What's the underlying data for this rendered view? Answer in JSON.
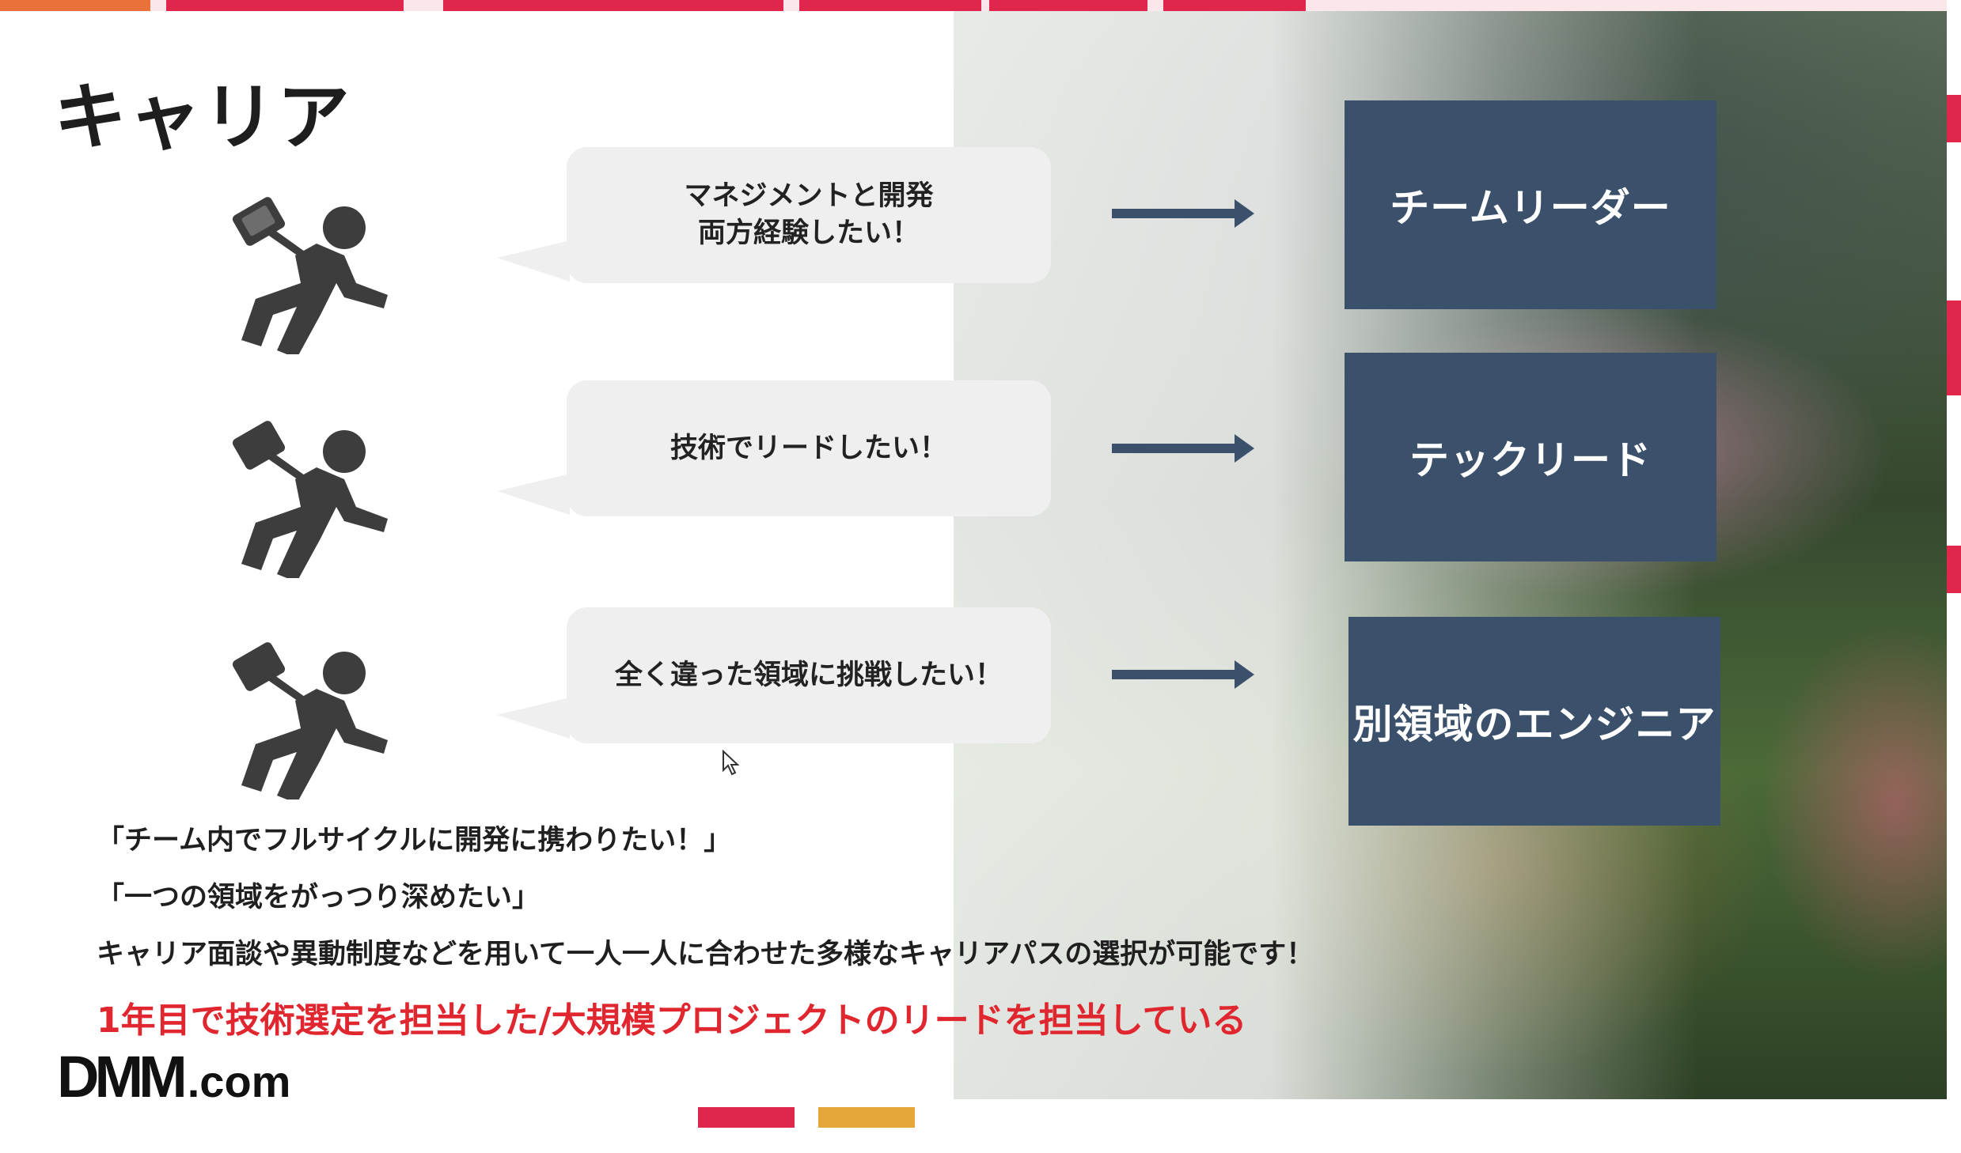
{
  "slide": {
    "title": "キャリア",
    "rows": [
      {
        "bubble": "マネジメントと開発\n両方経験したい！",
        "role": "チームリーダー"
      },
      {
        "bubble": "技術でリードしたい！",
        "role": "テックリード"
      },
      {
        "bubble": "全く違った領域に挑戦したい！",
        "role": "別領域のエンジニア"
      }
    ],
    "quotes": [
      "「チーム内でフルサイクルに開発に携わりたい！」",
      "「一つの領域をがっつり深めたい」",
      "キャリア面談や異動制度などを用いて一人一人に合わせた多様なキャリアパスの選択が可能です！"
    ],
    "highlight": "1年目で技術選定を担当した/大規模プロジェクトのリードを担当している",
    "logo": {
      "main": "DMM",
      "suffix": ".com"
    }
  },
  "icons": {
    "person": "running-businessman-icon",
    "arrow": "right-arrow-icon",
    "cursor": "mouse-pointer-icon"
  },
  "colors": {
    "role_box": "#3a506b",
    "bubble": "#efefef",
    "highlight": "#e0262e",
    "accent_red": "#e0264a",
    "accent_orange": "#e5a63a",
    "icon": "#3d3d3d"
  }
}
